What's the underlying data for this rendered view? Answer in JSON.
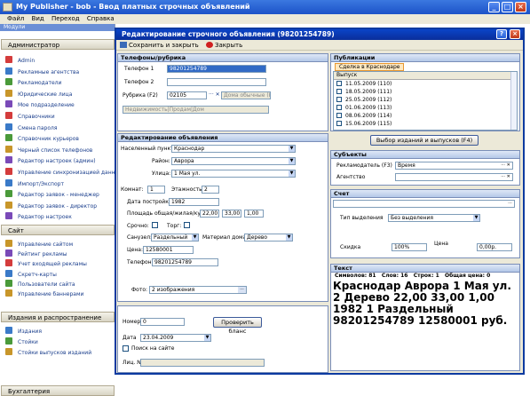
{
  "app": {
    "title": "My Publisher - bob - Ввод платных строчных объявлений"
  },
  "menu": [
    "Файл",
    "Вид",
    "Переход",
    "Справка"
  ],
  "left": {
    "modules_label": "Модули",
    "sections": [
      {
        "title": "Администратор",
        "items": [
          "Admin",
          "Рекламные агентства",
          "Рекламодатели",
          "Юридические лица",
          "Мое подразделение",
          "Справочники",
          "Смена пароля",
          "Справочник курьеров",
          "Черный список телефонов",
          "Редактор настроек (админ)",
          "Управление синхронизацией данных",
          "Импорт/Экспорт",
          "Редактор заявок - менеджер",
          "Редактор заявок - директор",
          "Редактор настроек"
        ]
      },
      {
        "title": "Сайт",
        "items": [
          "Управление сайтом",
          "Рейтинг рекламы",
          "Учет входящей рекламы",
          "Скретч-карты",
          "Пользователи сайта",
          "Управление баннерами"
        ]
      },
      {
        "title": "Издания и распространение",
        "items": [
          "Издания",
          "Стойки",
          "Стойки выпусков изданий"
        ]
      },
      {
        "title": "Бухгалтерия",
        "items": []
      }
    ]
  },
  "dialog": {
    "title": "Редактирование строчного объявления (98201254789)",
    "toolbar": {
      "save_close": "Сохранить и закрыть",
      "close": "Закрыть"
    },
    "phones": {
      "header": "Телефоны/рубрика",
      "phone1_label": "Телефон 1",
      "phone1": "98201254789",
      "phone2_label": "Телефон 2",
      "phone2": "",
      "rubric_label": "Рубрика (F2)",
      "rubric_code": "02105",
      "rubric_name": "Дома обычные (Ка...",
      "rubric_path": "Недвижимость|Продам|Дом"
    },
    "edit": {
      "header": "Редактирование объявления",
      "city_label": "Населенный пункт:",
      "city": "Краснодар",
      "district_label": "Район:",
      "district": "Аврора",
      "street_label": "Улица:",
      "street": "1 Мая ул.",
      "rooms_label": "Комнат:",
      "rooms": "1",
      "floors_label": "Этажность:",
      "floors": "2",
      "year_label": "Дата постройки:",
      "year": "1982",
      "area_label": "Площадь общая/жилая/кухня:",
      "area_total": "22,00",
      "area_living": "33,00",
      "area_kitchen": "1,00",
      "urgent_label": "Срочно:",
      "bargain_label": "Торг:",
      "bath_label": "Санузел:",
      "bath": "Раздельный",
      "material_label": "Материал дома:",
      "material": "Дерево",
      "price_label": "Цена:",
      "price": "12580001",
      "phone_label": "Телефон:",
      "phone": "98201254789",
      "photo_label": "Фото:",
      "photo": "2 изображения"
    },
    "form": {
      "number_label": "Номер",
      "number": "0",
      "check_btn": "Проверить бланс",
      "date_label": "Дата",
      "date": "23.04.2009",
      "search_label": "Поиск на сайте",
      "account_label": "Лиц. №"
    },
    "pubs": {
      "header": "Публикации",
      "tab": "Сделка в Краснодаре",
      "col": "Выпуск",
      "rows": [
        "11.05.2009 (110)",
        "18.05.2009 (111)",
        "25.05.2009 (112)",
        "01.06.2009 (113)",
        "08.06.2009 (114)",
        "15.06.2009 (115)"
      ],
      "select_btn": "Выбор изданий и выпусков (F4)"
    },
    "subjects": {
      "header": "Субъекты",
      "adv_label": "Рекламодатель (F3)",
      "adv": "Время",
      "agent_label": "Агентство",
      "agent": ""
    },
    "bill": {
      "header": "Счет",
      "sel_type_label": "Тип выделения",
      "sel_type": "Без выделения",
      "discount_label": "Скидка",
      "discount": "100%",
      "price_label": "Цена",
      "price": "0,00р."
    },
    "text": {
      "header": "Текст",
      "stats": {
        "symbols": "Символов: 81",
        "words": "Слов: 16",
        "lines": "Строк: 1",
        "total": "Общая цена: 0"
      },
      "body": "Краснодар Аврора 1 Мая ул. 2 Дерево 22,00 33,00 1,00 1982 1 Раздельный 98201254789 12580001 руб."
    }
  }
}
